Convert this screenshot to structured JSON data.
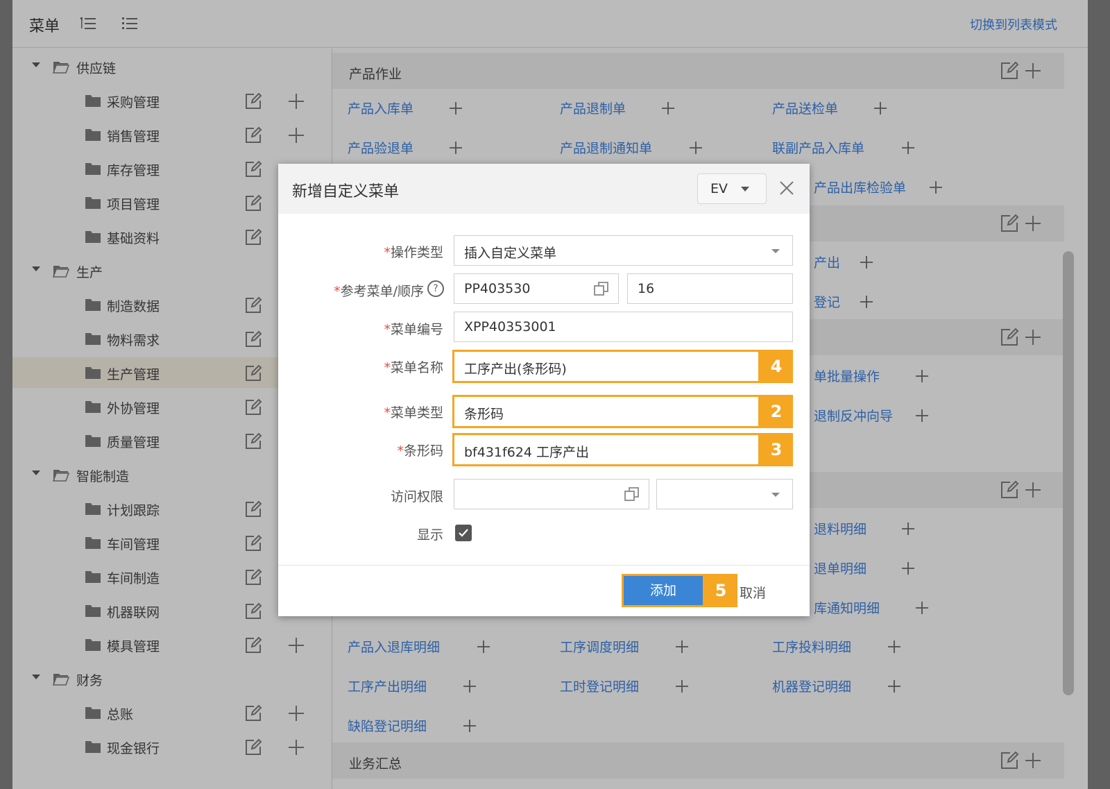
{
  "header": {
    "title": "菜单",
    "switch_label": "切换到列表模式"
  },
  "sidebar": {
    "groups": [
      {
        "label": "供应链",
        "items": [
          "采购管理",
          "销售管理",
          "库存管理",
          "项目管理",
          "基础资料"
        ]
      },
      {
        "label": "生产",
        "items": [
          "制造数据",
          "物料需求",
          "生产管理",
          "外协管理",
          "质量管理"
        ]
      },
      {
        "label": "智能制造",
        "items": [
          "计划跟踪",
          "车间管理",
          "车间制造",
          "机器联网",
          "模具管理"
        ]
      },
      {
        "label": "财务",
        "items": [
          "总账",
          "现金银行"
        ]
      }
    ],
    "selected": "生产管理"
  },
  "main": {
    "sections": [
      "产品作业",
      "业务汇总"
    ],
    "links": [
      "产品入库单",
      "产品退制单",
      "产品送检单",
      "产品验退单",
      "产品退制通知单",
      "联副产品入库单",
      "产品出库检验单",
      "产出",
      "登记",
      "单批量操作",
      "退制反冲向导",
      "退料明细",
      "退单明细",
      "库通知明细",
      "产品入退库明细",
      "工序调度明细",
      "工序投料明细",
      "工序产出明细",
      "工时登记明细",
      "机器登记明细",
      "缺陷登记明细"
    ]
  },
  "dialog": {
    "title": "新增自定义菜单",
    "lang": "EV",
    "fields": {
      "op_type": {
        "label": "操作类型",
        "value": "插入自定义菜单"
      },
      "ref_menu": {
        "label": "参考菜单/顺序",
        "value": "PP403530",
        "order": "16"
      },
      "menu_code": {
        "label": "菜单编号",
        "value": "XPP40353001"
      },
      "menu_name": {
        "label": "菜单名称",
        "value": "工序产出(条形码)"
      },
      "menu_type": {
        "label": "菜单类型",
        "value": "条形码"
      },
      "barcode": {
        "label": "条形码",
        "value": "bf431f624 工序产出"
      },
      "access": {
        "label": "访问权限",
        "value": ""
      },
      "show": {
        "label": "显示",
        "checked": true
      }
    },
    "required_mark": "*",
    "help_mark": "?",
    "add_label": "添加",
    "cancel_label": "取消"
  },
  "badges": [
    "4",
    "2",
    "3",
    "5"
  ],
  "colors": {
    "accent": "#3a7bd5",
    "highlight": "#f5a623",
    "required": "#e74c3c"
  }
}
